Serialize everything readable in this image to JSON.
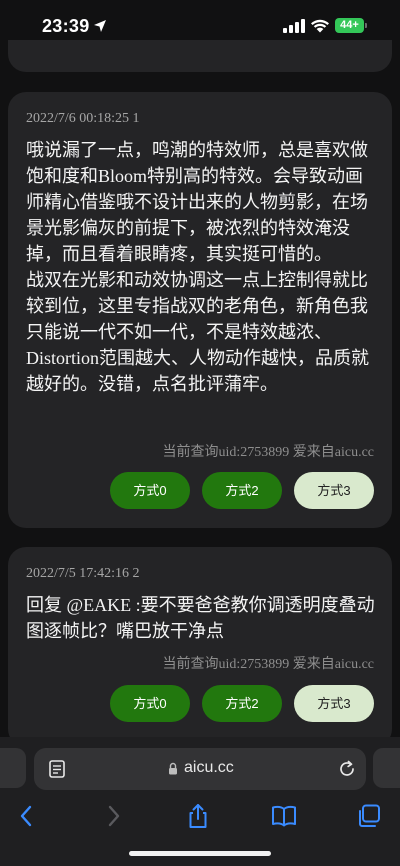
{
  "status_bar": {
    "time": "23:39",
    "battery": "44+",
    "icons": [
      "location-arrow-icon",
      "cellular-signal-icon",
      "wifi-icon",
      "battery-icon"
    ]
  },
  "comments": [
    {
      "meta": "2022/7/6 00:18:25 1",
      "body": "哦说漏了一点，鸣潮的特效师，总是喜欢做饱和度和Bloom特别高的特效。会导致动画师精心借鉴哦不设计出来的人物剪影，在场景光影偏灰的前提下，被浓烈的特效淹没掉，而且看着眼睛疼，其实挺可惜的。\n战双在光影和动效协调这一点上控制得就比较到位，这里专指战双的老角色，新角色我只能说一代不如一代，不是特效越浓、Distortion范围越大、人物动作越快，品质就越好的。没错，点名批评蒲牢。",
      "footer": "当前查询uid:2753899 爱来自aicu.cc",
      "buttons": [
        "方式0",
        "方式2",
        "方式3"
      ]
    },
    {
      "meta": "2022/7/5 17:42:16 2",
      "body": "回复 @EAKE :要不要爸爸教你调透明度叠动图逐帧比？嘴巴放干净点",
      "footer": "当前查询uid:2753899 爱来自aicu.cc",
      "buttons": [
        "方式0",
        "方式2",
        "方式3"
      ]
    }
  ],
  "browser": {
    "url": "aicu.cc",
    "toolbar": [
      "back-icon",
      "forward-icon",
      "share-icon",
      "bookmarks-icon",
      "tabs-icon"
    ]
  },
  "colors": {
    "background": "#111112",
    "card": "#242426",
    "button_dark": "#22780e",
    "button_light": "#d9e9cd",
    "toolbar_accent": "#3a8bff"
  }
}
